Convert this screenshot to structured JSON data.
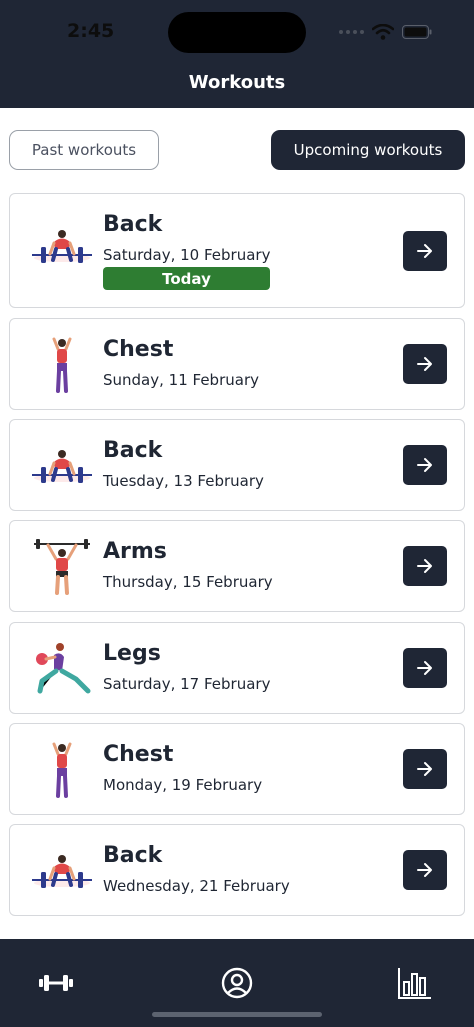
{
  "status": {
    "time": "2:45"
  },
  "header": {
    "title": "Workouts"
  },
  "tabs": {
    "past_label": "Past workouts",
    "upcoming_label": "Upcoming workouts",
    "selected": "upcoming"
  },
  "workouts": [
    {
      "title": "Back",
      "date": "Saturday, 10 February",
      "badge": "Today",
      "illustration": "deadlift-illustration"
    },
    {
      "title": "Chest",
      "date": "Sunday, 11 February",
      "illustration": "flex-illustration"
    },
    {
      "title": "Back",
      "date": "Tuesday, 13 February",
      "illustration": "deadlift-illustration"
    },
    {
      "title": "Arms",
      "date": "Thursday, 15 February",
      "illustration": "overhead-press-illustration"
    },
    {
      "title": "Legs",
      "date": "Saturday, 17 February",
      "illustration": "lunge-illustration"
    },
    {
      "title": "Chest",
      "date": "Monday, 19 February",
      "illustration": "flex-illustration"
    },
    {
      "title": "Back",
      "date": "Wednesday, 21 February",
      "illustration": "deadlift-illustration"
    }
  ],
  "bottom_nav": {
    "items": [
      "dumbbell-icon",
      "profile-icon",
      "stats-icon"
    ]
  },
  "colors": {
    "navy": "#1f2635",
    "today_green": "#2e7d32",
    "card_border": "#d6d8dc"
  }
}
